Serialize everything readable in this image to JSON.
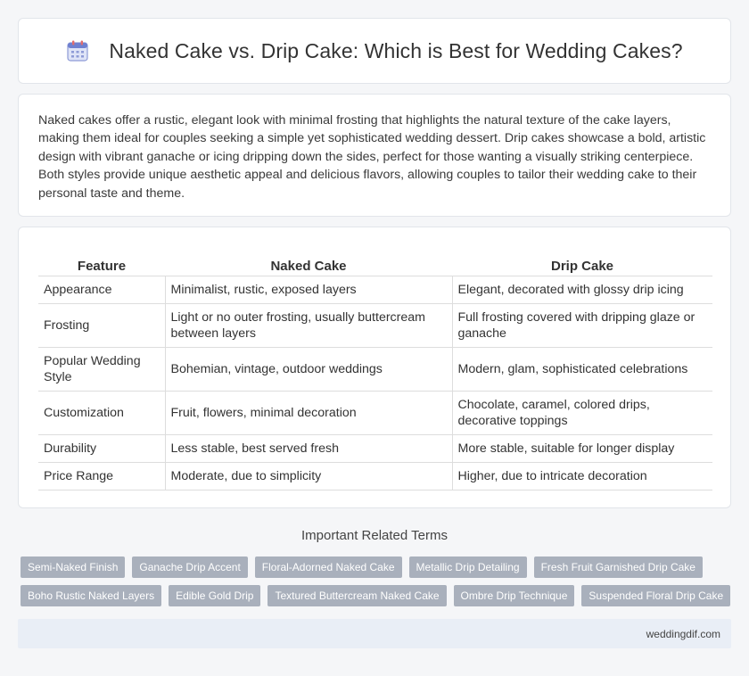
{
  "header": {
    "title": "Naked Cake vs. Drip Cake: Which is Best for Wedding Cakes?",
    "icon": "calendar-icon"
  },
  "intro": {
    "text": "Naked cakes offer a rustic, elegant look with minimal frosting that highlights the natural texture of the cake layers, making them ideal for couples seeking a simple yet sophisticated wedding dessert. Drip cakes showcase a bold, artistic design with vibrant ganache or icing dripping down the sides, perfect for those wanting a visually striking centerpiece. Both styles provide unique aesthetic appeal and delicious flavors, allowing couples to tailor their wedding cake to their personal taste and theme."
  },
  "table": {
    "headers": [
      "Feature",
      "Naked Cake",
      "Drip Cake"
    ],
    "rows": [
      [
        "Appearance",
        "Minimalist, rustic, exposed layers",
        "Elegant, decorated with glossy drip icing"
      ],
      [
        "Frosting",
        "Light or no outer frosting, usually buttercream between layers",
        "Full frosting covered with dripping glaze or ganache"
      ],
      [
        "Popular Wedding Style",
        "Bohemian, vintage, outdoor weddings",
        "Modern, glam, sophisticated celebrations"
      ],
      [
        "Customization",
        "Fruit, flowers, minimal decoration",
        "Chocolate, caramel, colored drips, decorative toppings"
      ],
      [
        "Durability",
        "Less stable, best served fresh",
        "More stable, suitable for longer display"
      ],
      [
        "Price Range",
        "Moderate, due to simplicity",
        "Higher, due to intricate decoration"
      ]
    ]
  },
  "related": {
    "title": "Important Related Terms",
    "tags": [
      "Semi-Naked Finish",
      "Ganache Drip Accent",
      "Floral-Adorned Naked Cake",
      "Metallic Drip Detailing",
      "Fresh Fruit Garnished Drip Cake",
      "Boho Rustic Naked Layers",
      "Edible Gold Drip",
      "Textured Buttercream Naked Cake",
      "Ombre Drip Technique",
      "Suspended Floral Drip Cake"
    ]
  },
  "footer": {
    "site": "weddingdif.com"
  },
  "colors": {
    "tag_bg": "#a9b0bc",
    "footer_bg": "#e9eef6",
    "page_bg": "#f5f6f8"
  }
}
